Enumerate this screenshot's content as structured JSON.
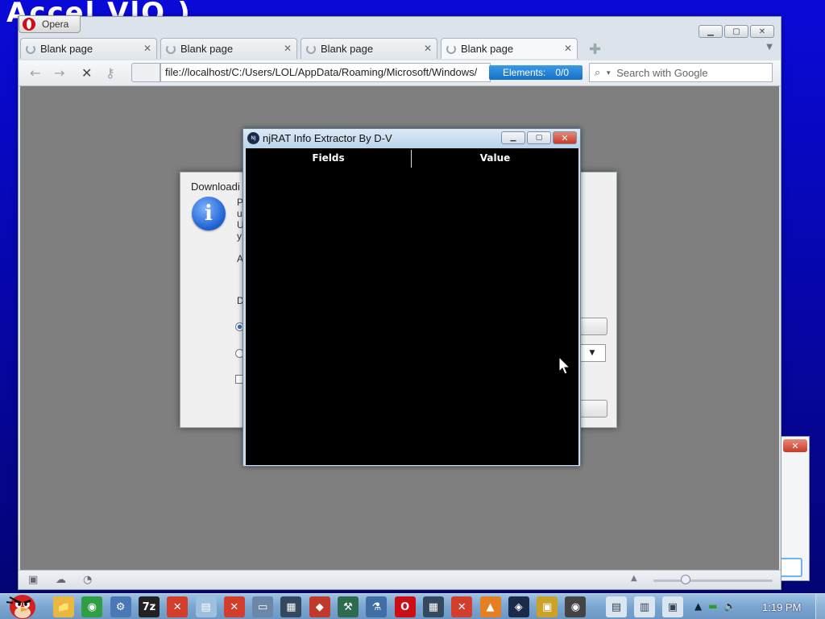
{
  "desktop": {
    "background_text": "Ãccel VlO.)"
  },
  "opera": {
    "menu_label": "Opera",
    "tabs": [
      {
        "label": "Blank page"
      },
      {
        "label": "Blank page"
      },
      {
        "label": "Blank page"
      },
      {
        "label": "Blank page"
      }
    ],
    "address": "file://localhost/C:/Users/LOL/AppData/Roaming/Microsoft/Windows/",
    "elements_label": "Elements:",
    "elements_value": "0/0",
    "search_placeholder": "Search with Google"
  },
  "download_dialog": {
    "title": "Downloadi",
    "fragments": [
      "P",
      "u",
      "U",
      "y",
      "A",
      "D"
    ]
  },
  "njrat": {
    "title": "njRAT Info Extractor By D-V",
    "icon_label": "NJ",
    "columns": [
      "Fields",
      "Value"
    ]
  },
  "taskbar": {
    "clock": "1:19 PM",
    "tasks": [
      {
        "icon": "folder-icon",
        "glyph": "📁",
        "color": "#e8b93e"
      },
      {
        "icon": "chrome-icon",
        "glyph": "◉",
        "color": "#2f9e44"
      },
      {
        "icon": "network-icon",
        "glyph": "⚙",
        "color": "#4a78b5"
      },
      {
        "icon": "7zip-icon",
        "glyph": "7z",
        "color": "#222222"
      },
      {
        "icon": "error-icon",
        "glyph": "✕",
        "color": "#d33d2c"
      },
      {
        "icon": "notepad-icon",
        "glyph": "▤",
        "color": "#9cc0de"
      },
      {
        "icon": "error-icon",
        "glyph": "✕",
        "color": "#d33d2c"
      },
      {
        "icon": "window-icon",
        "glyph": "▭",
        "color": "#6c87a8"
      },
      {
        "icon": "app-icon",
        "glyph": "▦",
        "color": "#34495e"
      },
      {
        "icon": "media-icon",
        "glyph": "◆",
        "color": "#c0392b"
      },
      {
        "icon": "tool-icon",
        "glyph": "⚒",
        "color": "#2d6a4f"
      },
      {
        "icon": "python-icon",
        "glyph": "⚗",
        "color": "#3f6fa5"
      },
      {
        "icon": "opera-icon",
        "glyph": "O",
        "color": "#cc0f16"
      },
      {
        "icon": "app-icon",
        "glyph": "▦",
        "color": "#34495e"
      },
      {
        "icon": "error-icon",
        "glyph": "✕",
        "color": "#d33d2c"
      },
      {
        "icon": "vlc-icon",
        "glyph": "▲",
        "color": "#e67e22"
      },
      {
        "icon": "njrat-icon",
        "glyph": "◈",
        "color": "#1a2a4a"
      },
      {
        "icon": "disk-icon",
        "glyph": "▣",
        "color": "#c9a227"
      },
      {
        "icon": "eye-icon",
        "glyph": "◉",
        "color": "#444444"
      }
    ],
    "tray_icons": [
      {
        "icon": "document-icon",
        "glyph": "▤"
      },
      {
        "icon": "archive-icon",
        "glyph": "▥"
      },
      {
        "icon": "screen-icon",
        "glyph": "▣"
      }
    ]
  }
}
